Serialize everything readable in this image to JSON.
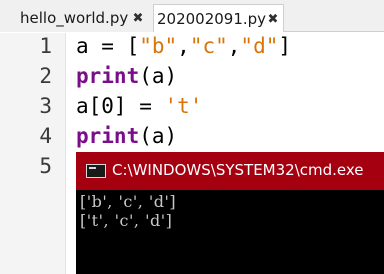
{
  "tabs": [
    {
      "label": "hello_world.py",
      "active": false
    },
    {
      "label": "202002091.py",
      "active": true
    }
  ],
  "close_glyph": "✖",
  "editor": {
    "line_numbers": [
      "1",
      "2",
      "3",
      "4",
      "5"
    ],
    "lines": [
      [
        "a",
        " = [",
        "\"b\"",
        ",",
        "\"c\"",
        ",",
        "\"d\"",
        "]"
      ],
      [
        "print",
        "(a)"
      ],
      [
        "a[0] = ",
        "'t'"
      ],
      [
        "print",
        "(a)"
      ]
    ]
  },
  "console": {
    "title": "C:\\WINDOWS\\SYSTEM32\\cmd.exe",
    "output": [
      "['b', 'c', 'd']",
      "['t', 'c', 'd']"
    ]
  },
  "colors": {
    "keyword": "#7a0d8a",
    "string": "#d8750a",
    "cmd_titlebar": "#a40010",
    "cmd_background": "#000000"
  }
}
